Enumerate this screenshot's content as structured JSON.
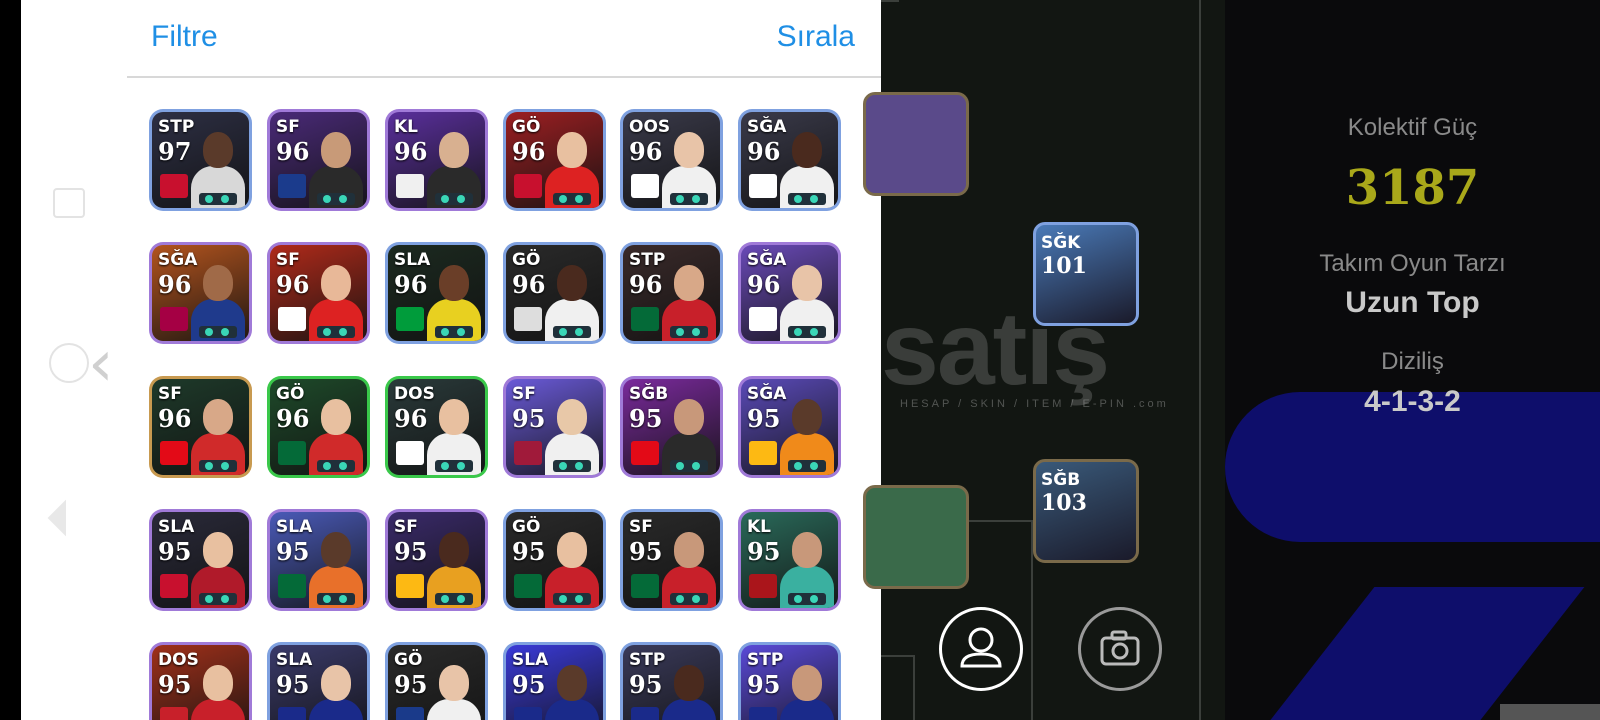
{
  "panel": {
    "filter_label": "Filtre",
    "sort_label": "Sırala"
  },
  "cards": [
    {
      "pos": "STP",
      "rating": "97",
      "border": "#7fa1e0",
      "bg": "#2d2f44",
      "skin": "#5a3a2a",
      "shirt": "#d8d8d8",
      "badge": "#c8102e"
    },
    {
      "pos": "SF",
      "rating": "96",
      "border": "#a07ad8",
      "bg": "#4a2a78",
      "skin": "#c89a78",
      "shirt": "#2a2a2a",
      "badge": "#1b3b8c"
    },
    {
      "pos": "KL",
      "rating": "96",
      "border": "#a07ad8",
      "bg": "#5a2f9c",
      "skin": "#d8b090",
      "shirt": "#2a2a2a",
      "badge": "#f0f0f0"
    },
    {
      "pos": "GÖ",
      "rating": "96",
      "border": "#7fa1e0",
      "bg": "#9c1f22",
      "skin": "#e8c0a0",
      "shirt": "#d22",
      "badge": "#c8102e"
    },
    {
      "pos": "OOS",
      "rating": "96",
      "border": "#7fa1e0",
      "bg": "#3a3a4a",
      "skin": "#e8c4a8",
      "shirt": "#f0f0f0",
      "badge": "#ffffff"
    },
    {
      "pos": "SĞA",
      "rating": "96",
      "border": "#7fa1e0",
      "bg": "#3a3a4a",
      "skin": "#4a2a1e",
      "shirt": "#f0f0f0",
      "badge": "#ffffff"
    },
    {
      "pos": "SĞA",
      "rating": "96",
      "border": "#a07ad8",
      "bg": "#b3541e",
      "skin": "#a06a48",
      "shirt": "#1f3a8c",
      "badge": "#a50044"
    },
    {
      "pos": "SF",
      "rating": "96",
      "border": "#a07ad8",
      "bg": "#b02a1a",
      "skin": "#e8b898",
      "shirt": "#d22",
      "badge": "#ffffff"
    },
    {
      "pos": "SLA",
      "rating": "96",
      "border": "#7fa1e0",
      "bg": "#1c2a20",
      "skin": "#6a3e28",
      "shirt": "#e8d020",
      "badge": "#009c3b"
    },
    {
      "pos": "GÖ",
      "rating": "96",
      "border": "#7fa1e0",
      "bg": "#2a2a2a",
      "skin": "#4a2a1e",
      "shirt": "#f0f0f0",
      "badge": "#dddddd"
    },
    {
      "pos": "STP",
      "rating": "96",
      "border": "#7fa1e0",
      "bg": "#3a2a2a",
      "skin": "#d8a888",
      "shirt": "#c8202a",
      "badge": "#046a38"
    },
    {
      "pos": "SĞA",
      "rating": "96",
      "border": "#a07ad8",
      "bg": "#6a4ab8",
      "skin": "#e8c4a8",
      "shirt": "#f0f0f0",
      "badge": "#ffffff"
    },
    {
      "pos": "SF",
      "rating": "96",
      "border": "#c89a50",
      "bg": "#1e3a2a",
      "skin": "#d8a888",
      "shirt": "#d02a2a",
      "badge": "#e30a17"
    },
    {
      "pos": "GÖ",
      "rating": "96",
      "border": "#3ac84a",
      "bg": "#1e4a2a",
      "skin": "#e8c0a0",
      "shirt": "#d02a2a",
      "badge": "#046a38"
    },
    {
      "pos": "DOS",
      "rating": "96",
      "border": "#3ac84a",
      "bg": "#2a3a3a",
      "skin": "#e8c0a0",
      "shirt": "#f0f0f0",
      "badge": "#ffffff"
    },
    {
      "pos": "SF",
      "rating": "95",
      "border": "#a07ad8",
      "bg": "#6a5ad8",
      "skin": "#e8c8a8",
      "shirt": "#f0f0f0",
      "badge": "#a01a3a"
    },
    {
      "pos": "SĞB",
      "rating": "95",
      "border": "#a07ad8",
      "bg": "#7a2a9c",
      "skin": "#c8987a",
      "shirt": "#2a2a2a",
      "badge": "#e30a17"
    },
    {
      "pos": "SĞA",
      "rating": "95",
      "border": "#a07ad8",
      "bg": "#5a4ab8",
      "skin": "#5a3a2a",
      "shirt": "#f08a1a",
      "badge": "#fdb913"
    },
    {
      "pos": "SLA",
      "rating": "95",
      "border": "#a07ad8",
      "bg": "#2a2a3a",
      "skin": "#e8c0a0",
      "shirt": "#b01a2a",
      "badge": "#c8102e"
    },
    {
      "pos": "SLA",
      "rating": "95",
      "border": "#a07ad8",
      "bg": "#4a5ab8",
      "skin": "#5a3a2a",
      "shirt": "#e8702a",
      "badge": "#046a38"
    },
    {
      "pos": "SF",
      "rating": "95",
      "border": "#a07ad8",
      "bg": "#3a2a6a",
      "skin": "#4a2a1e",
      "shirt": "#e8a020",
      "badge": "#fdb913"
    },
    {
      "pos": "GÖ",
      "rating": "95",
      "border": "#7fa1e0",
      "bg": "#2a2a2a",
      "skin": "#e8c0a0",
      "shirt": "#c8202a",
      "badge": "#046a38"
    },
    {
      "pos": "SF",
      "rating": "95",
      "border": "#7fa1e0",
      "bg": "#2a2a2a",
      "skin": "#c8987a",
      "shirt": "#c8202a",
      "badge": "#046a38"
    },
    {
      "pos": "KL",
      "rating": "95",
      "border": "#a07ad8",
      "bg": "#2a6a5a",
      "skin": "#c8987a",
      "shirt": "#3ab0a0",
      "badge": "#aa151b"
    },
    {
      "pos": "DOS",
      "rating": "95",
      "border": "#a07ad8",
      "bg": "#a0301a",
      "skin": "#e8c0a0",
      "shirt": "#c8202a",
      "badge": "#c8202a"
    },
    {
      "pos": "SLA",
      "rating": "95",
      "border": "#7fa1e0",
      "bg": "#3a3a6a",
      "skin": "#e8c4a8",
      "shirt": "#1a2a8a",
      "badge": "#1a2a8a"
    },
    {
      "pos": "GÖ",
      "rating": "95",
      "border": "#7fa1e0",
      "bg": "#2a2a2a",
      "skin": "#e8c4a8",
      "shirt": "#f0f0f0",
      "badge": "#1a3a8a"
    },
    {
      "pos": "SLA",
      "rating": "95",
      "border": "#7fa1e0",
      "bg": "#3a3ad8",
      "skin": "#5a3a2a",
      "shirt": "#1a2a8a",
      "badge": "#1a2a8a"
    },
    {
      "pos": "STP",
      "rating": "95",
      "border": "#7fa1e0",
      "bg": "#3a3a5a",
      "skin": "#4a2a1e",
      "shirt": "#1a2a8a",
      "badge": "#1a2a8a"
    },
    {
      "pos": "STP",
      "rating": "95",
      "border": "#7fa1e0",
      "bg": "#5a4ad8",
      "skin": "#c8987a",
      "shirt": "#1a2a8a",
      "badge": "#1a2a8a"
    }
  ],
  "field_cards": [
    {
      "pos": "SĞK",
      "rating": "101",
      "bg": "#4a7ab8"
    },
    {
      "pos": "SĞB",
      "rating": "103",
      "bg": "#3a5a7a"
    }
  ],
  "team": {
    "power_label": "Kolektif Güç",
    "power_value": "3187",
    "style_label": "Takım Oyun Tarzı",
    "style_value": "Uzun Top",
    "formation_label": "Diziliş",
    "formation_value": "4-1-3-2"
  },
  "watermark": {
    "brand": "satış",
    "tagline": "HESAP / SKIN / ITEM / E-PIN .com"
  },
  "colors": {
    "accent": "#1f8fe5",
    "power": "#a9a81a",
    "blue_shape": "#0e0e6b"
  }
}
